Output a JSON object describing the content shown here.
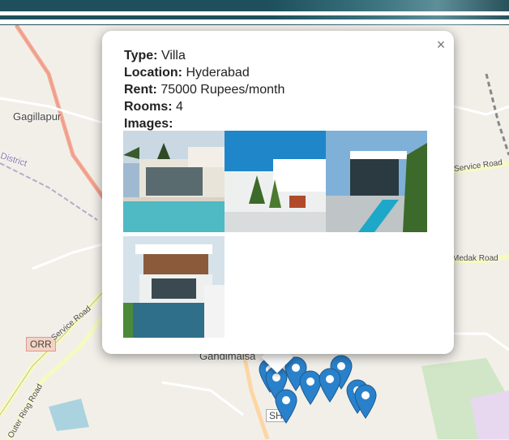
{
  "popup": {
    "close_glyph": "×",
    "fields": [
      {
        "label": "Type:",
        "value": "Villa"
      },
      {
        "label": "Location:",
        "value": "Hyderabad"
      },
      {
        "label": "Rent:",
        "value": "75000 Rupees/month"
      },
      {
        "label": "Rooms:",
        "value": "4"
      }
    ],
    "images_label": "Images:",
    "images": [
      {
        "icon": "villa-photo-1"
      },
      {
        "icon": "villa-photo-2"
      },
      {
        "icon": "villa-photo-3"
      },
      {
        "icon": "villa-photo-4"
      }
    ]
  },
  "map": {
    "labels": {
      "gagillapur": "Gagillapur",
      "district": "District",
      "orr": "ORR",
      "service_road_left": "Service Road",
      "outer_ring_road": "Outer Ring Road",
      "service_road_right": "Service Road",
      "medak_road": "Medak Road",
      "gandimaisa": "Gandimaisa",
      "sh": "SH"
    },
    "colors": {
      "marker": "#2a81cb",
      "road_main": "#f5a98b",
      "road_minor": "#f7fabf"
    }
  }
}
